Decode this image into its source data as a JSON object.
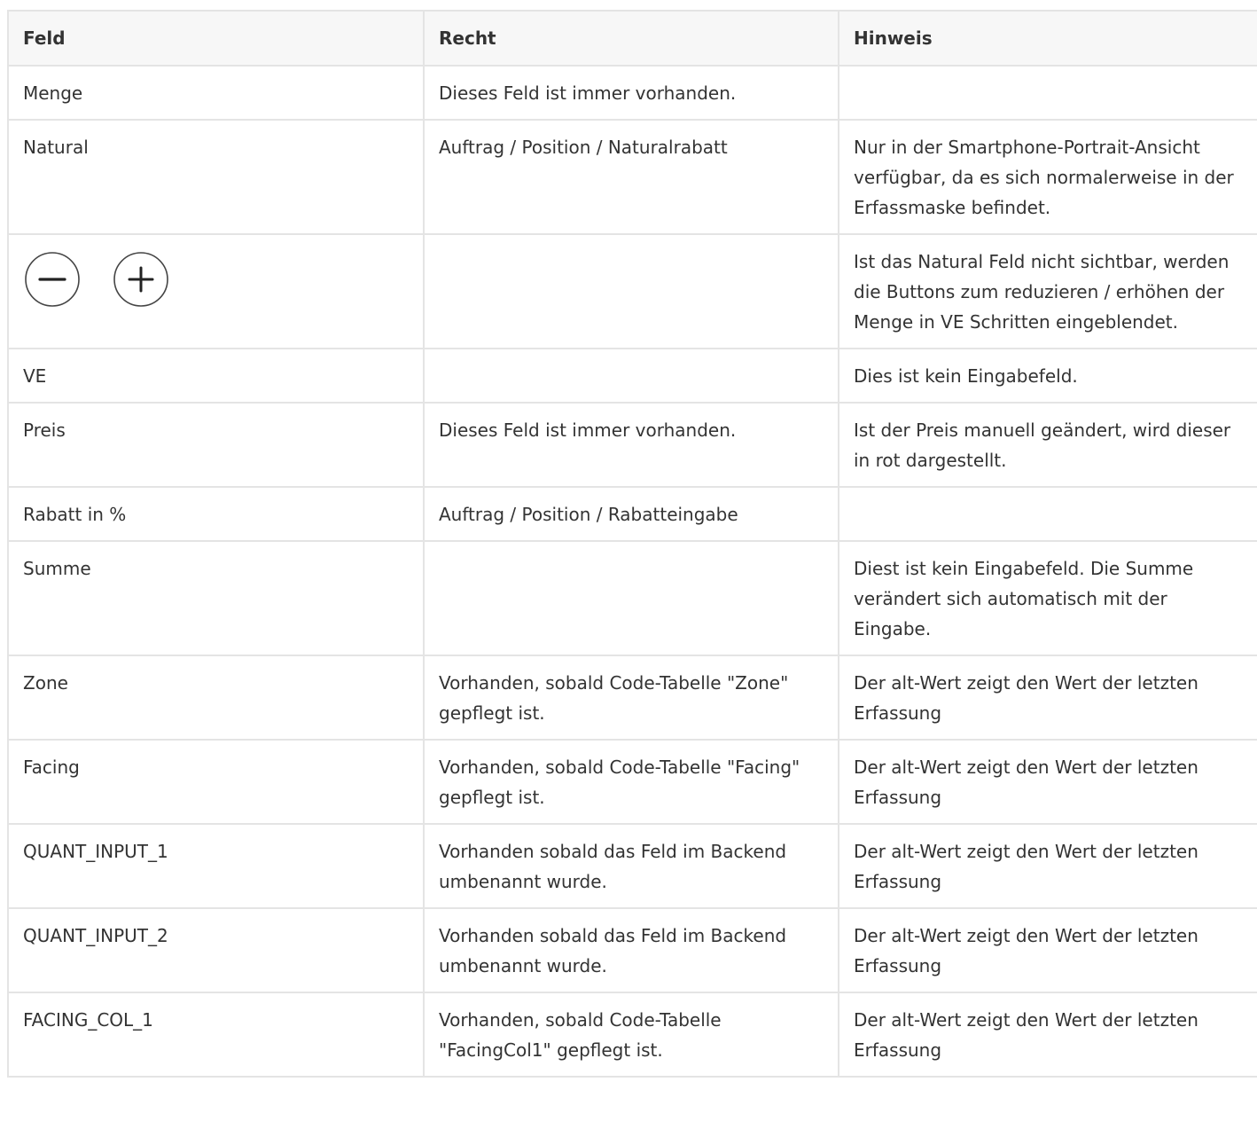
{
  "table": {
    "headers": [
      "Feld",
      "Recht",
      "Hinweis"
    ],
    "rows": [
      {
        "feld": "Menge",
        "recht": "Dieses Feld ist immer vorhanden.",
        "hinweis": ""
      },
      {
        "feld": "Natural",
        "recht": "Auftrag / Position / Naturalrabatt",
        "hinweis": "Nur in der Smartphone-Portrait-Ansicht verfügbar, da es sich normalerweise in der Erfassmaske befindet."
      },
      {
        "feld": "",
        "feld_icons": [
          "minus-circle-icon",
          "plus-circle-icon"
        ],
        "recht": "",
        "hinweis": "Ist das Natural Feld nicht sichtbar, werden die Buttons zum reduzieren / erhöhen der Menge in VE Schritten eingeblendet."
      },
      {
        "feld": "VE",
        "recht": "",
        "hinweis": "Dies ist kein Eingabefeld."
      },
      {
        "feld": "Preis",
        "recht": "Dieses Feld ist immer vorhanden.",
        "hinweis": "Ist der Preis manuell geändert, wird dieser in rot dargestellt."
      },
      {
        "feld": "Rabatt in %",
        "recht": "Auftrag / Position / Rabatteingabe",
        "hinweis": ""
      },
      {
        "feld": "Summe",
        "recht": "",
        "hinweis": "Diest ist kein Eingabefeld. Die Summe verändert sich automatisch mit der Eingabe."
      },
      {
        "feld": "Zone",
        "recht": "Vorhanden, sobald Code-Tabelle \"Zone\" gepflegt ist.",
        "hinweis": "Der alt-Wert zeigt den Wert der letzten Erfassung"
      },
      {
        "feld": "Facing",
        "recht": "Vorhanden, sobald Code-Tabelle \"Facing\" gepflegt ist.",
        "hinweis": "Der alt-Wert zeigt den Wert der letzten Erfassung"
      },
      {
        "feld": "QUANT_INPUT_1",
        "recht": "Vorhanden sobald das Feld im Backend umbenannt wurde.",
        "hinweis": "Der alt-Wert zeigt den Wert der letzten Erfassung"
      },
      {
        "feld": "QUANT_INPUT_2",
        "recht": "Vorhanden sobald das Feld im Backend umbenannt wurde.",
        "hinweis": "Der alt-Wert zeigt den Wert der letzten Erfassung"
      },
      {
        "feld": "FACING_COL_1",
        "recht": "Vorhanden, sobald Code-Tabelle \"FacingCol1\" gepflegt ist.",
        "hinweis": "Der alt-Wert zeigt den Wert der letzten Erfassung"
      }
    ]
  }
}
